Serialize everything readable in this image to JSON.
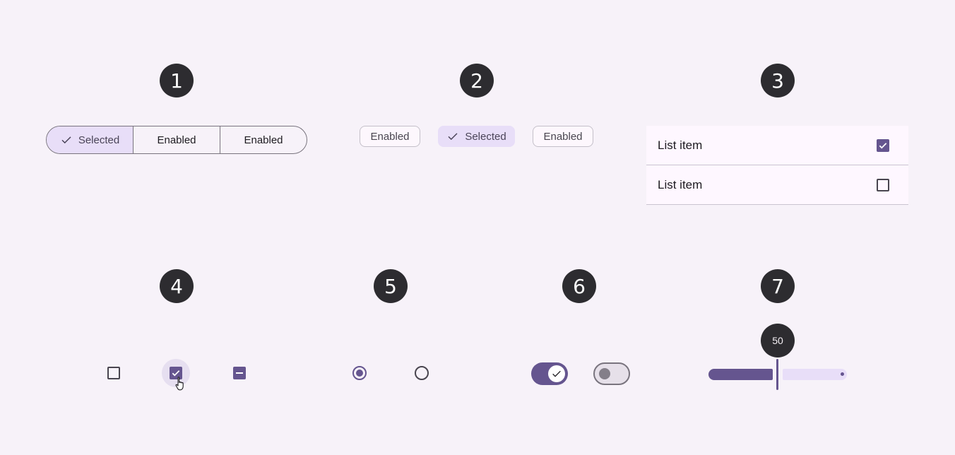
{
  "badges": [
    "1",
    "2",
    "3",
    "4",
    "5",
    "6",
    "7"
  ],
  "segmented_button": {
    "segments": [
      {
        "label": "Selected",
        "selected": true
      },
      {
        "label": "Enabled",
        "selected": false
      },
      {
        "label": "Enabled",
        "selected": false
      }
    ]
  },
  "chips": [
    {
      "label": "Enabled",
      "selected": false
    },
    {
      "label": "Selected",
      "selected": true
    },
    {
      "label": "Enabled",
      "selected": false
    }
  ],
  "list": {
    "items": [
      {
        "label": "List item",
        "checked": true
      },
      {
        "label": "List item",
        "checked": false
      }
    ]
  },
  "checkboxes": [
    {
      "state": "unchecked"
    },
    {
      "state": "checked",
      "hovered": true
    },
    {
      "state": "indeterminate"
    }
  ],
  "radios": [
    {
      "selected": true
    },
    {
      "selected": false
    }
  ],
  "switches": [
    {
      "on": true,
      "icon": "check-icon"
    },
    {
      "on": false
    }
  ],
  "slider": {
    "value": 50,
    "value_label": "50",
    "min": 0,
    "max": 100
  },
  "colors": {
    "primary": "#65558f",
    "secondary_container": "#e8def8",
    "badge": "#2d2c30",
    "background": "#f7f2f9"
  }
}
